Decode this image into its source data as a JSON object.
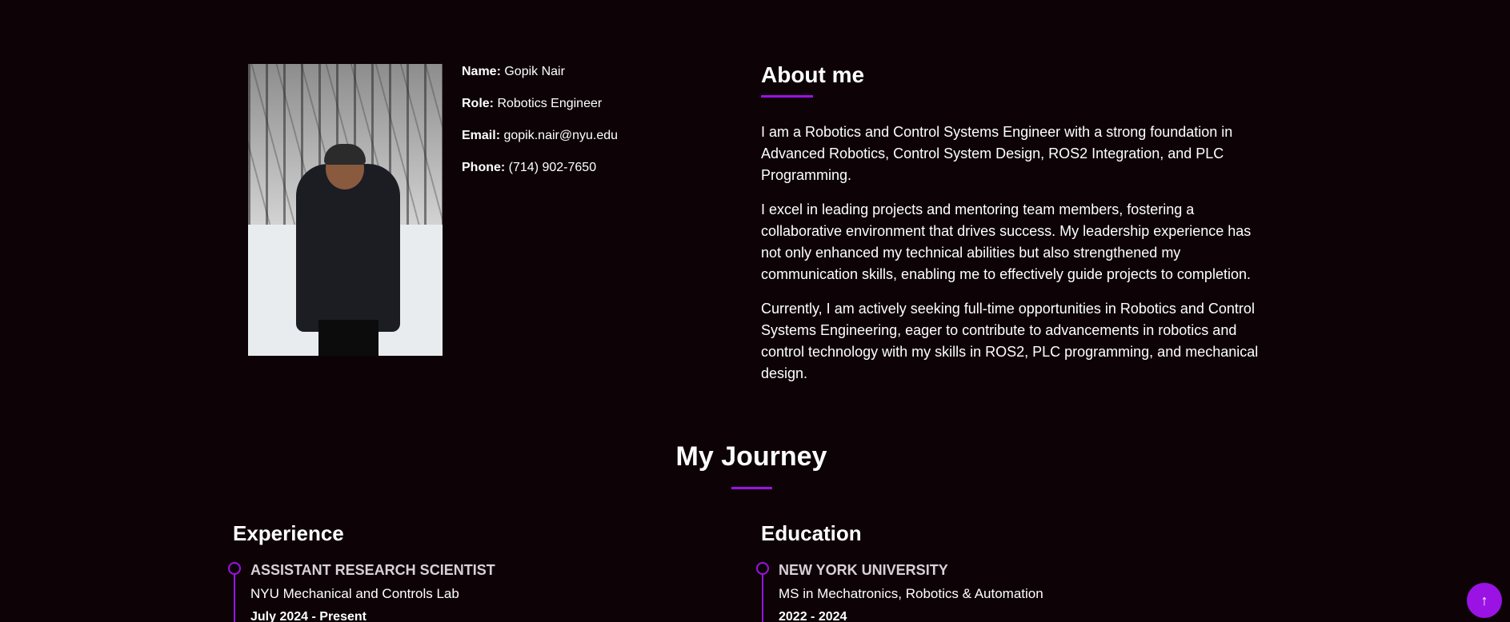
{
  "profile": {
    "photo_alt": "Profile photo",
    "fields": [
      {
        "label": "Name:",
        "value": "Gopik Nair"
      },
      {
        "label": "Role:",
        "value": "Robotics Engineer"
      },
      {
        "label": "Email:",
        "value": "gopik.nair@nyu.edu"
      },
      {
        "label": "Phone:",
        "value": "(714) 902-7650"
      }
    ]
  },
  "about": {
    "title": "About me",
    "paragraphs": [
      "I am a Robotics and Control Systems Engineer with a strong foundation in Advanced Robotics, Control System Design, ROS2 Integration, and PLC Programming.",
      "I excel in leading projects and mentoring team members, fostering a collaborative environment that drives success. My leadership experience has not only enhanced my technical abilities but also strengthened my communication skills, enabling me to effectively guide projects to completion.",
      "Currently, I am actively seeking full-time opportunities in Robotics and Control Systems Engineering, eager to contribute to advancements in robotics and control technology with my skills in ROS2, PLC programming, and mechanical design."
    ]
  },
  "journey": {
    "title": "My Journey",
    "experience": {
      "title": "Experience",
      "items": [
        {
          "heading": "ASSISTANT RESEARCH SCIENTIST",
          "sub": "NYU Mechanical and Controls Lab",
          "date": "July 2024 - Present"
        }
      ]
    },
    "education": {
      "title": "Education",
      "items": [
        {
          "heading": "NEW YORK UNIVERSITY",
          "sub": "MS in Mechatronics, Robotics & Automation",
          "date": "2022 - 2024"
        }
      ]
    }
  },
  "scroll_top": {
    "icon": "arrow-up-icon",
    "glyph": "↑"
  },
  "colors": {
    "background": "#0d0306",
    "accent": "#9b12e5"
  }
}
